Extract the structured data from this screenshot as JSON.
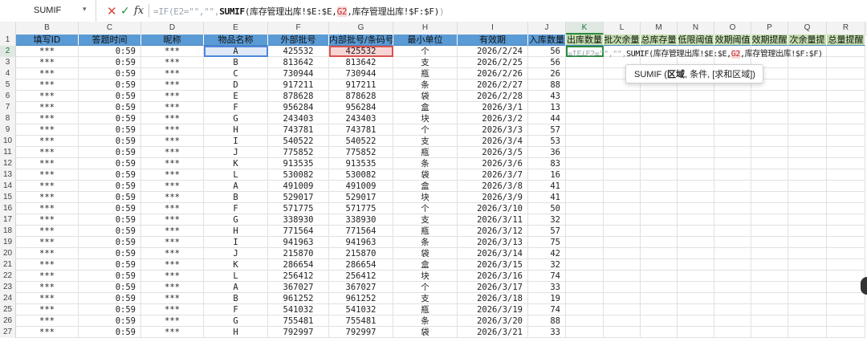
{
  "formula_bar": {
    "name_box": "SUMIF",
    "name_box_dropdown": "▾",
    "cancel_icon": "✕",
    "enter_icon": "✓",
    "fx_label": "fx",
    "formula_prefix": "=IF(E2=\"\",\"\",",
    "formula_func": "SUMIF",
    "formula_a": "(库存管理出库!$E:$E,",
    "formula_ref": "G2",
    "formula_b": ",库存管理出库!$F:$F)",
    "formula_tail": ")"
  },
  "columns": [
    "B",
    "C",
    "D",
    "E",
    "F",
    "G",
    "H",
    "I",
    "J",
    "K",
    "L",
    "M",
    "N",
    "O",
    "P",
    "Q",
    "R"
  ],
  "active_column": "K",
  "headers": [
    "填写ID",
    "答题时间",
    "昵称",
    "物品名称",
    "外部批号",
    "内部批号/条码号",
    "最小单位",
    "有效期",
    "入库数量",
    "出库数量",
    "批次余量",
    "总库存量",
    "低限阈值",
    "效期阈值",
    "效期提醒",
    "次余量提",
    "总量提醒"
  ],
  "rows": [
    {
      "n": "2",
      "id": "***",
      "t": "0:59",
      "nick": "***",
      "name": "A",
      "ext": "425532",
      "int": "425532",
      "unit": "个",
      "exp": "2026/2/24",
      "qty": "56"
    },
    {
      "n": "3",
      "id": "***",
      "t": "0:59",
      "nick": "***",
      "name": "B",
      "ext": "813642",
      "int": "813642",
      "unit": "支",
      "exp": "2026/2/25",
      "qty": "56"
    },
    {
      "n": "4",
      "id": "***",
      "t": "0:59",
      "nick": "***",
      "name": "C",
      "ext": "730944",
      "int": "730944",
      "unit": "瓶",
      "exp": "2026/2/26",
      "qty": "26"
    },
    {
      "n": "5",
      "id": "***",
      "t": "0:59",
      "nick": "***",
      "name": "D",
      "ext": "917211",
      "int": "917211",
      "unit": "条",
      "exp": "2026/2/27",
      "qty": "88"
    },
    {
      "n": "6",
      "id": "***",
      "t": "0:59",
      "nick": "***",
      "name": "E",
      "ext": "878628",
      "int": "878628",
      "unit": "袋",
      "exp": "2026/2/28",
      "qty": "43"
    },
    {
      "n": "7",
      "id": "***",
      "t": "0:59",
      "nick": "***",
      "name": "F",
      "ext": "956284",
      "int": "956284",
      "unit": "盒",
      "exp": "2026/3/1",
      "qty": "13"
    },
    {
      "n": "8",
      "id": "***",
      "t": "0:59",
      "nick": "***",
      "name": "G",
      "ext": "243403",
      "int": "243403",
      "unit": "块",
      "exp": "2026/3/2",
      "qty": "44"
    },
    {
      "n": "9",
      "id": "***",
      "t": "0:59",
      "nick": "***",
      "name": "H",
      "ext": "743781",
      "int": "743781",
      "unit": "个",
      "exp": "2026/3/3",
      "qty": "57"
    },
    {
      "n": "10",
      "id": "***",
      "t": "0:59",
      "nick": "***",
      "name": "I",
      "ext": "540522",
      "int": "540522",
      "unit": "支",
      "exp": "2026/3/4",
      "qty": "53"
    },
    {
      "n": "11",
      "id": "***",
      "t": "0:59",
      "nick": "***",
      "name": "J",
      "ext": "775852",
      "int": "775852",
      "unit": "瓶",
      "exp": "2026/3/5",
      "qty": "36"
    },
    {
      "n": "12",
      "id": "***",
      "t": "0:59",
      "nick": "***",
      "name": "K",
      "ext": "913535",
      "int": "913535",
      "unit": "条",
      "exp": "2026/3/6",
      "qty": "83"
    },
    {
      "n": "13",
      "id": "***",
      "t": "0:59",
      "nick": "***",
      "name": "L",
      "ext": "530082",
      "int": "530082",
      "unit": "袋",
      "exp": "2026/3/7",
      "qty": "16"
    },
    {
      "n": "14",
      "id": "***",
      "t": "0:59",
      "nick": "***",
      "name": "A",
      "ext": "491009",
      "int": "491009",
      "unit": "盒",
      "exp": "2026/3/8",
      "qty": "41"
    },
    {
      "n": "15",
      "id": "***",
      "t": "0:59",
      "nick": "***",
      "name": "B",
      "ext": "529017",
      "int": "529017",
      "unit": "块",
      "exp": "2026/3/9",
      "qty": "41"
    },
    {
      "n": "16",
      "id": "***",
      "t": "0:59",
      "nick": "***",
      "name": "F",
      "ext": "571775",
      "int": "571775",
      "unit": "个",
      "exp": "2026/3/10",
      "qty": "50"
    },
    {
      "n": "17",
      "id": "***",
      "t": "0:59",
      "nick": "***",
      "name": "G",
      "ext": "338930",
      "int": "338930",
      "unit": "支",
      "exp": "2026/3/11",
      "qty": "32"
    },
    {
      "n": "18",
      "id": "***",
      "t": "0:59",
      "nick": "***",
      "name": "H",
      "ext": "771564",
      "int": "771564",
      "unit": "瓶",
      "exp": "2026/3/12",
      "qty": "57"
    },
    {
      "n": "19",
      "id": "***",
      "t": "0:59",
      "nick": "***",
      "name": "I",
      "ext": "941963",
      "int": "941963",
      "unit": "条",
      "exp": "2026/3/13",
      "qty": "75"
    },
    {
      "n": "20",
      "id": "***",
      "t": "0:59",
      "nick": "***",
      "name": "J",
      "ext": "215870",
      "int": "215870",
      "unit": "袋",
      "exp": "2026/3/14",
      "qty": "42"
    },
    {
      "n": "21",
      "id": "***",
      "t": "0:59",
      "nick": "***",
      "name": "K",
      "ext": "286654",
      "int": "286654",
      "unit": "盒",
      "exp": "2026/3/15",
      "qty": "32"
    },
    {
      "n": "22",
      "id": "***",
      "t": "0:59",
      "nick": "***",
      "name": "L",
      "ext": "256412",
      "int": "256412",
      "unit": "块",
      "exp": "2026/3/16",
      "qty": "74"
    },
    {
      "n": "23",
      "id": "***",
      "t": "0:59",
      "nick": "***",
      "name": "A",
      "ext": "367027",
      "int": "367027",
      "unit": "个",
      "exp": "2026/3/17",
      "qty": "33"
    },
    {
      "n": "24",
      "id": "***",
      "t": "0:59",
      "nick": "***",
      "name": "B",
      "ext": "961252",
      "int": "961252",
      "unit": "支",
      "exp": "2026/3/18",
      "qty": "19"
    },
    {
      "n": "25",
      "id": "***",
      "t": "0:59",
      "nick": "***",
      "name": "F",
      "ext": "541032",
      "int": "541032",
      "unit": "瓶",
      "exp": "2026/3/19",
      "qty": "74"
    },
    {
      "n": "26",
      "id": "***",
      "t": "0:59",
      "nick": "***",
      "name": "G",
      "ext": "755481",
      "int": "755481",
      "unit": "条",
      "exp": "2026/3/20",
      "qty": "88"
    },
    {
      "n": "27",
      "id": "***",
      "t": "0:59",
      "nick": "***",
      "name": "H",
      "ext": "792997",
      "int": "792997",
      "unit": "袋",
      "exp": "2026/3/21",
      "qty": "33"
    }
  ],
  "active_cell": {
    "ref": "K2",
    "prefix": "=IF(E2=\"\",\"\",",
    "func": "SUMIF",
    "args_a": "(库存管理出库!$E:$E,",
    "ref_cell": "G2",
    "args_b": ",库存管理出库!$F:$F)"
  },
  "tooltip": {
    "func": "SUMIF",
    "open": " (",
    "arg_range": "区域",
    "arg_rest": ", 条件, [求和区域])"
  },
  "colors": {
    "header_blue": "#5b9bd5",
    "header_green": "#c4dfae",
    "active_green": "#2b8a3e",
    "ref_red": "#d9534f",
    "sel_blue": "#4f86d9"
  }
}
